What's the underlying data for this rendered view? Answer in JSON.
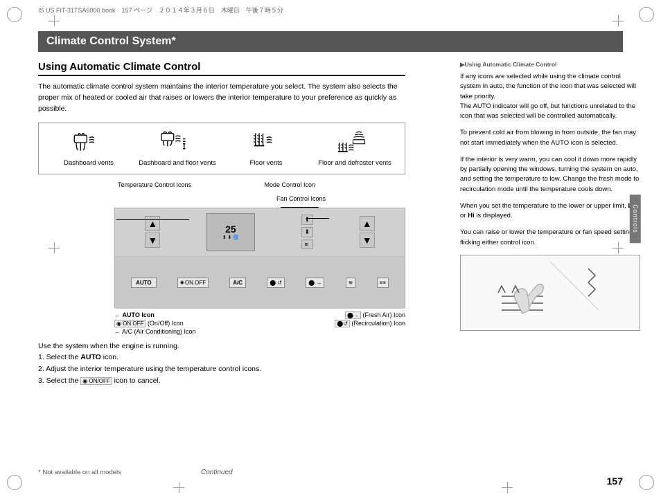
{
  "page": {
    "number": "157",
    "file_info": "IS US FIT-31TSA6000.book　157 ページ　２０１４年３月６日　木曜日　午後７時５分",
    "title": "Climate Control System*",
    "footnote": "* Not available on all models",
    "continued": "Continued"
  },
  "section": {
    "title": "Using Automatic Climate Control",
    "intro": "The automatic climate control system maintains the interior temperature you select. The system also selects the proper mix of heated or cooled air that raises or lowers the interior temperature to your preference as quickly as possible."
  },
  "vent_items": [
    {
      "label": "Dashboard vents"
    },
    {
      "label": "Dashboard and floor vents"
    },
    {
      "label": "Floor vents"
    },
    {
      "label": "Floor and defroster vents"
    }
  ],
  "diagram": {
    "temp_label": "Temperature Control Icons",
    "mode_label": "Mode Control Icon",
    "fan_label": "Fan Control Icons",
    "auto_label": "AUTO Icon",
    "onoff_label": "(On/Off) Icon",
    "ac_label": "A/C (Air Conditioning) Icon",
    "fresh_label": "(Fresh Air) Icon",
    "recirc_label": "(Recirculation) Icon",
    "temp_display": "25"
  },
  "instructions": {
    "intro": "Use the system when the engine is running.",
    "step1_prefix": "1. Select the ",
    "step1_bold": "AUTO",
    "step1_suffix": " icon.",
    "step2": "2. Adjust the interior temperature using the temperature control icons.",
    "step3_prefix": "3. Select the ",
    "step3_suffix": " icon to cancel."
  },
  "sidebar": {
    "section_label": "▶Using Automatic Climate Control",
    "para1": "If any icons are selected while using the climate control system in auto, the function of the icon that was selected will take priority.\nThe AUTO indicator will go off, but functions unrelated to the icon that was selected will be controlled automatically.",
    "para2": "To prevent cold air from blowing in from outside, the fan may not start immediately when the AUTO icon is selected.",
    "para3": "If the interior is very warm, you can cool it down more rapidly by partially opening the windows, turning the system on auto, and setting the temperature to low. Change the fresh mode to recirculation mode until the temperature cools down.",
    "para4": "When you set the temperature to the lower or upper limit, Lo or Hi is displayed.",
    "para5": "You can raise or lower the temperature or fan speed setting flicking either control icon.",
    "controls_tab": "Controls"
  }
}
